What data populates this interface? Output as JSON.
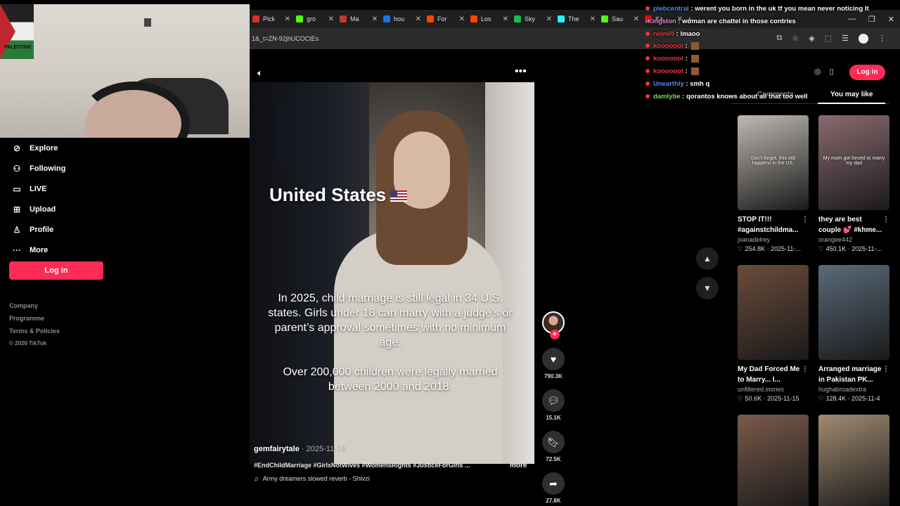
{
  "browser": {
    "tabs": [
      {
        "label": "Pick",
        "color": "#d93025"
      },
      {
        "label": "gro",
        "color": "#53fc18"
      },
      {
        "label": "Ma",
        "color": "#c0392b"
      },
      {
        "label": "hou",
        "color": "#1a73e8"
      },
      {
        "label": "For",
        "color": "#ff4500"
      },
      {
        "label": "Los",
        "color": "#ff4500"
      },
      {
        "label": "Sky",
        "color": "#1db954"
      },
      {
        "label": "The",
        "color": "#25f4ee"
      },
      {
        "label": "Sau",
        "color": "#53fc18"
      },
      {
        "label": "Ka",
        "color": "#ff0000"
      }
    ],
    "url": "1&_t=ZN-92jhUCOCtEs",
    "window_controls": [
      "—",
      "❐",
      "✕"
    ]
  },
  "webcam": {
    "flag_text": "PALESTINE"
  },
  "leftnav": {
    "items": [
      {
        "label": "Explore",
        "icon": "compass-icon"
      },
      {
        "label": "Following",
        "icon": "user-follow-icon"
      },
      {
        "label": "LIVE",
        "icon": "live-tv-icon"
      },
      {
        "label": "Upload",
        "icon": "plus-square-icon"
      },
      {
        "label": "Profile",
        "icon": "person-icon"
      },
      {
        "label": "More",
        "icon": "ellipsis-icon"
      }
    ],
    "login_label": "Log in",
    "footer": {
      "company": "Company",
      "programme": "Programme",
      "terms": "Terms & Policies",
      "copyright": "© 2026 TikTok"
    }
  },
  "video": {
    "title": "United States",
    "overlay_p1": "In 2025, child marriage is still legal in 34 U.S. states. Girls under 18 can marry with a judge’s or parent’s approval sometimes with no minimum age.",
    "overlay_p2": "Over 200,000 children were legally married between 2000 and 2018.",
    "author": "gemfairytale",
    "date": "2025-11-18",
    "caption": "#EndChildMarriage #GirlsNotWives #WomensRights #JusticeForGirls ...",
    "more": "more",
    "music": "Army dreamers slowed reverb - Shivzi"
  },
  "actions": {
    "likes": "790.3K",
    "comments": "15.1K",
    "saves": "72.5K",
    "shares": "27.8K"
  },
  "chat": [
    {
      "user": "plebcentral",
      "color": "#4a90e2",
      "msg": "werent you born in the uk tf you mean never noticing It",
      "badge": true
    },
    {
      "user": "iKingston",
      "color": "#e38bd6",
      "msg": "woman are chattel in those contries",
      "badge": false
    },
    {
      "user": "nein69",
      "color": "#e33b3b",
      "msg": "lmaoo",
      "badge": true
    },
    {
      "user": "kooooool",
      "color": "#e33b3b",
      "msg": "",
      "badge": true,
      "emote": true
    },
    {
      "user": "kooooool",
      "color": "#e33b3b",
      "msg": "",
      "badge": true,
      "emote": true
    },
    {
      "user": "kooooool",
      "color": "#e33b3b",
      "msg": "",
      "badge": true,
      "emote": true
    },
    {
      "user": "Unearthly",
      "color": "#4a90e2",
      "msg": "smh q",
      "badge": true
    },
    {
      "user": "damlybe",
      "color": "#7ed957",
      "msg": "qorantos knows about all that too well",
      "badge": true
    }
  ],
  "right_panel": {
    "login_label": "Log in",
    "tab_comments": "Comments",
    "tab_you_may_like": "You may like",
    "cards": [
      {
        "title": "STOP IT!!! #againstchildma...",
        "user": "jxanadelrey",
        "likes": "254.8K",
        "date": "2025-11-...",
        "thumb_text": "Don't forget, this still happens in the US.",
        "bg": "#bfb9b2"
      },
      {
        "title": "they are best couple 💕 #khme...",
        "user": "orangee442",
        "likes": "450.1K",
        "date": "2025-11-...",
        "thumb_text": "My mom got forced to marry my dad",
        "bg": "#8a6a70"
      },
      {
        "title": "My Dad Forced Me to Marry... I...",
        "user": "unfiltered.stories",
        "likes": "50.6K",
        "date": "2025-11-15",
        "thumb_text": "",
        "bg": "#6b4c3a"
      },
      {
        "title": "Arranged marriage in Pakistan PK...",
        "user": "hughabroadextra",
        "likes": "128.4K",
        "date": "2025-11-4",
        "thumb_text": "",
        "bg": "#5a6a7a"
      },
      {
        "title": "",
        "user": "",
        "likes": "",
        "date": "",
        "thumb_text": "",
        "bg": "#7a5a4a"
      },
      {
        "title": "",
        "user": "",
        "likes": "",
        "date": "",
        "thumb_text": "",
        "bg": "#a08a70"
      }
    ]
  }
}
